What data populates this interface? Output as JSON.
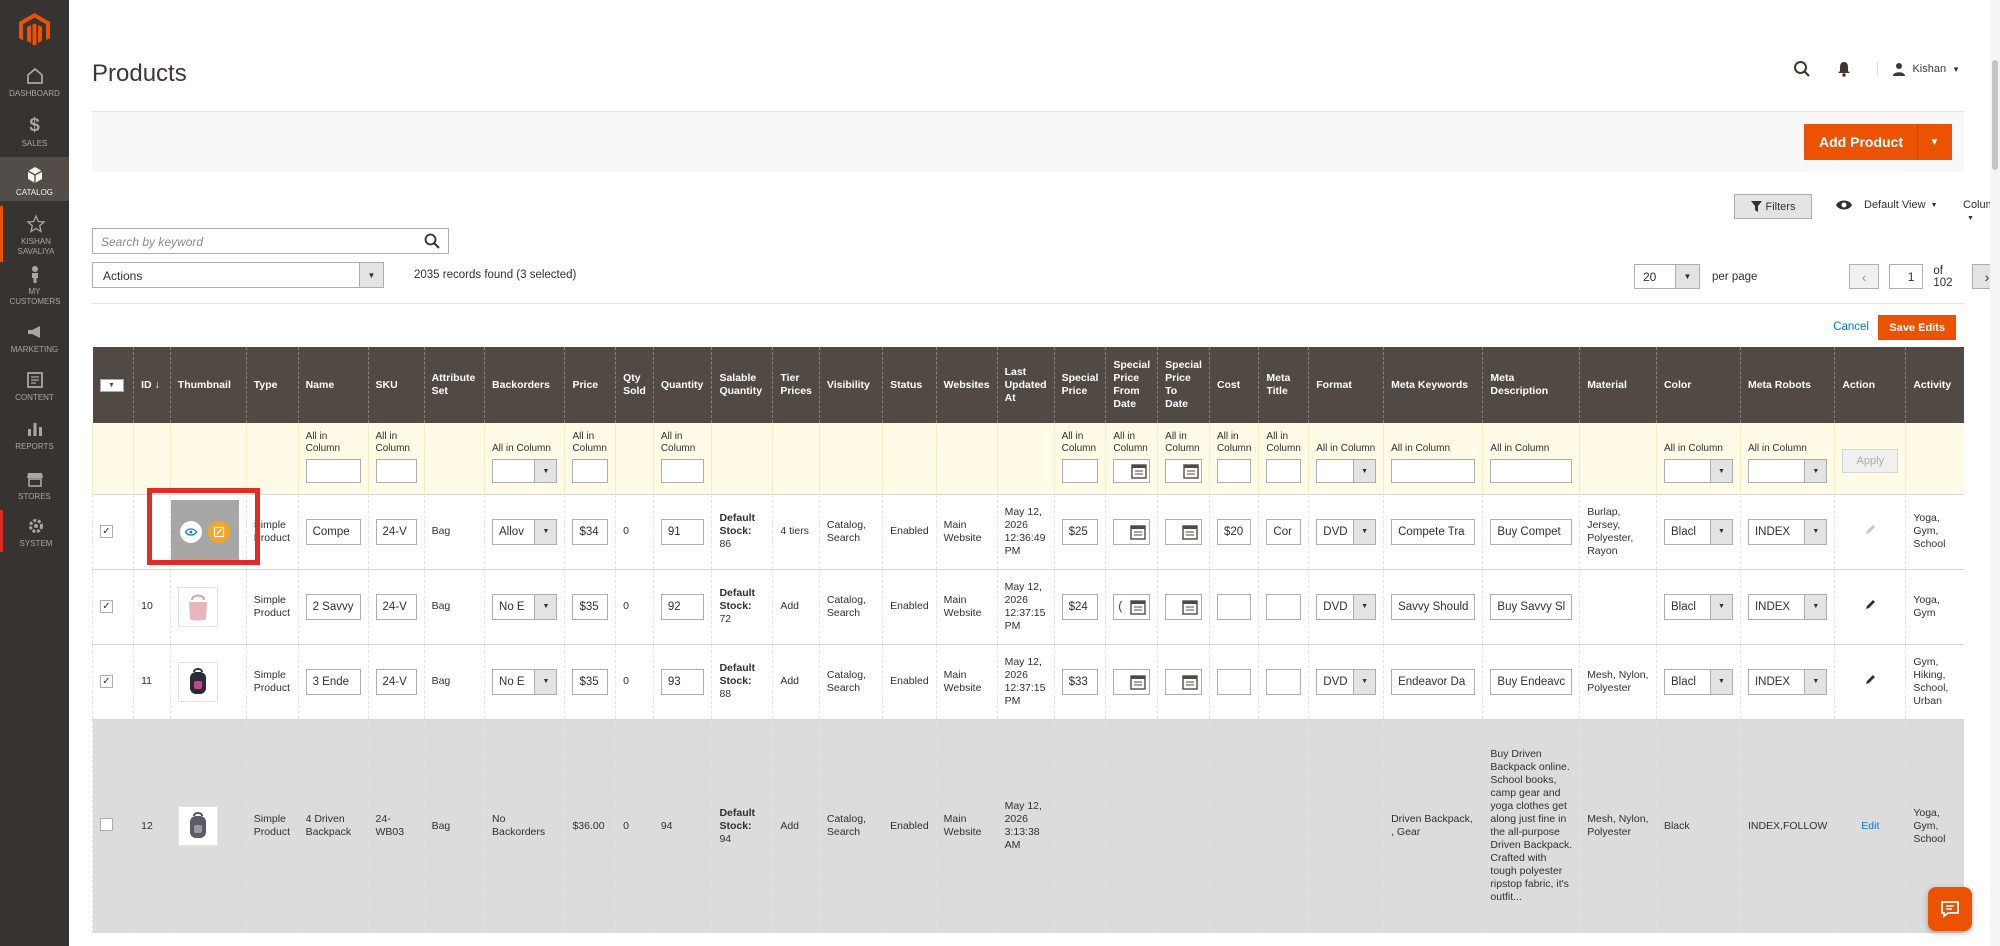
{
  "sidebar": {
    "items": [
      {
        "label": "DASHBOARD",
        "icon": "dashboard-icon"
      },
      {
        "label": "SALES",
        "icon": "dollar-icon"
      },
      {
        "label": "CATALOG",
        "icon": "cube-icon"
      },
      {
        "label": "KISHAN SAVALIYA",
        "icon": "star-icon"
      },
      {
        "label": "MY CUSTOMERS",
        "icon": "person-icon"
      },
      {
        "label": "MARKETING",
        "icon": "megaphone-icon"
      },
      {
        "label": "CONTENT",
        "icon": "content-icon"
      },
      {
        "label": "REPORTS",
        "icon": "bar-chart-icon"
      },
      {
        "label": "STORES",
        "icon": "store-icon"
      },
      {
        "label": "SYSTEM",
        "icon": "gear-icon"
      }
    ]
  },
  "header": {
    "title": "Products",
    "user": "Kishan"
  },
  "toolbar": {
    "add_product": "Add Product",
    "filters": "Filters",
    "default_view": "Default View",
    "columns": "Columns",
    "search_placeholder": "Search by keyword",
    "actions": "Actions",
    "records": "2035 records found (3 selected)",
    "per_page_value": "20",
    "per_page_label": "per page",
    "page_value": "1",
    "page_total": "of 102",
    "cancel": "Cancel",
    "save_edits": "Save Edits"
  },
  "columns": [
    "ID",
    "Thumbnail",
    "Type",
    "Name",
    "SKU",
    "Attribute Set",
    "Backorders",
    "Price",
    "Qty Sold",
    "Quantity",
    "Salable Quantity",
    "Tier Prices",
    "Visibility",
    "Status",
    "Websites",
    "Last Updated At",
    "Special Price",
    "Special Price From Date",
    "Special Price To Date",
    "Cost",
    "Meta Title",
    "Format",
    "Meta Keywords",
    "Meta Description",
    "Material",
    "Color",
    "Meta Robots",
    "Action",
    "Activity"
  ],
  "filter_label": "All in Column",
  "apply": "Apply",
  "rows": [
    {
      "id": "",
      "type": "Simple Product",
      "name": "Compe",
      "sku": "24-V",
      "attr": "Bag",
      "backorders": "Allov",
      "price": "$34",
      "qty_sold": "0",
      "quantity": "91",
      "salable_label": "Default Stock:",
      "salable_value": "86",
      "tier": "4 tiers",
      "visibility": "Catalog, Search",
      "status": "Enabled",
      "websites": "Main Website",
      "updated": "May 12, 2026 12:36:49 PM",
      "special": "$25",
      "spec_from": "",
      "spec_to": "",
      "cost": "$20",
      "meta_title": "Cor",
      "format": "DVD",
      "meta_kw": "Compete Tra",
      "meta_desc": "Buy Compet",
      "material": "Burlap, Jersey, Polyester, Rayon",
      "color": "Blacl",
      "robots": "INDEX",
      "activity": "Yoga, Gym, School"
    },
    {
      "id": "10",
      "type": "Simple Product",
      "name": "2 Savvy",
      "sku": "24-V",
      "attr": "Bag",
      "backorders": "No E",
      "price": "$35",
      "qty_sold": "0",
      "quantity": "92",
      "salable_label": "Default Stock:",
      "salable_value": "72",
      "tier": "Add",
      "visibility": "Catalog, Search",
      "status": "Enabled",
      "websites": "Main Website",
      "updated": "May 12, 2026 12:37:15 PM",
      "special": "$24",
      "spec_from": "(",
      "spec_to": "",
      "cost": "",
      "meta_title": "",
      "format": "DVD",
      "meta_kw": "Savvy Should",
      "meta_desc": "Buy Savvy Sl",
      "material": "",
      "color": "Blacl",
      "robots": "INDEX",
      "activity": "Yoga, Gym"
    },
    {
      "id": "11",
      "type": "Simple Product",
      "name": "3 Ende",
      "sku": "24-V",
      "attr": "Bag",
      "backorders": "No E",
      "price": "$35",
      "qty_sold": "0",
      "quantity": "93",
      "salable_label": "Default Stock:",
      "salable_value": "88",
      "tier": "Add",
      "visibility": "Catalog, Search",
      "status": "Enabled",
      "websites": "Main Website",
      "updated": "May 12, 2026 12:37:15 PM",
      "special": "$33",
      "spec_from": "",
      "spec_to": "",
      "cost": "",
      "meta_title": "",
      "format": "DVD",
      "meta_kw": "Endeavor Da",
      "meta_desc": "Buy Endeavc",
      "material": "Mesh, Nylon, Polyester",
      "color": "Blacl",
      "robots": "INDEX",
      "activity": "Gym, Hiking, School, Urban"
    },
    {
      "id": "12",
      "type": "Simple Product",
      "name": "4 Driven Backpack",
      "sku": "24-WB03",
      "attr": "Bag",
      "backorders": "No Backorders",
      "price": "$36.00",
      "qty_sold": "0",
      "quantity": "94",
      "salable_label": "Default Stock:",
      "salable_value": "94",
      "tier": "Add",
      "visibility": "Catalog, Search",
      "status": "Enabled",
      "websites": "Main Website",
      "updated": "May 12, 2026 3:13:38 AM",
      "meta_kw": "Driven Backpack, , Gear",
      "meta_desc": "Buy Driven Backpack online. School books, camp gear and yoga clothes get along just fine in the all-purpose Driven Backpack. Crafted with tough polyester ripstop fabric, it's outfit...",
      "material": "Mesh, Nylon, Polyester",
      "color": "Black",
      "robots": "INDEX,FOLLOW",
      "action": "Edit",
      "activity": "Yoga, Gym, School"
    }
  ],
  "colors": {
    "accent": "#eb5202",
    "header_bg": "#514943",
    "sidebar_bg": "#373330",
    "highlight": "#e02b27"
  }
}
